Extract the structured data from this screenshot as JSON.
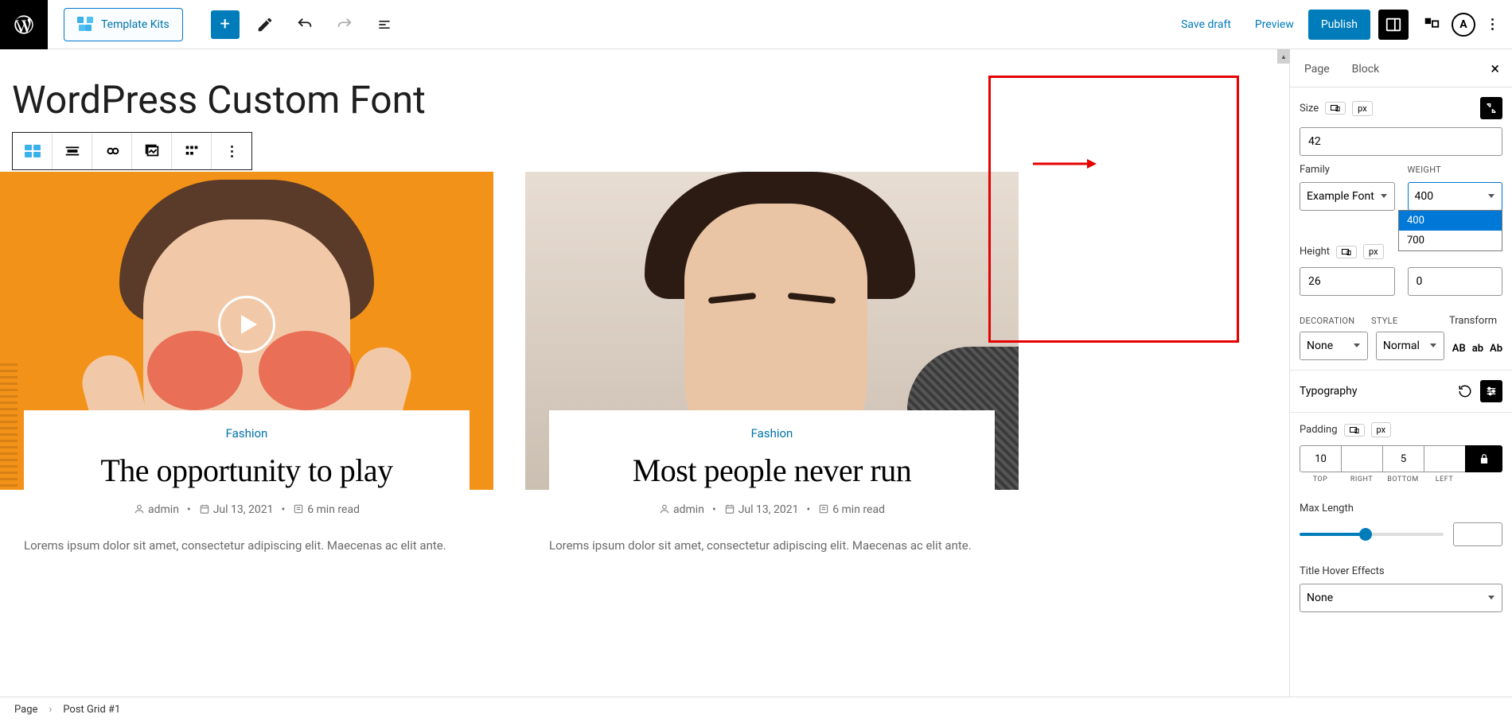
{
  "topbar": {
    "template_kits": "Template Kits",
    "save_draft": "Save draft",
    "preview": "Preview",
    "publish": "Publish",
    "astra": "A"
  },
  "canvas": {
    "page_title": "WordPress Custom Font"
  },
  "posts": [
    {
      "category": "Fashion",
      "title": "The opportunity to play",
      "author": "admin",
      "date": "Jul 13, 2021",
      "read": "6 min read",
      "excerpt": "Lorems ipsum dolor sit amet, consectetur adipiscing elit. Maecenas ac elit ante."
    },
    {
      "category": "Fashion",
      "title": "Most people never run",
      "author": "admin",
      "date": "Jul 13, 2021",
      "read": "6 min read",
      "excerpt": "Lorems ipsum dolor sit amet, consectetur adipiscing elit. Maecenas ac elit ante."
    }
  ],
  "sidebar": {
    "tabs": {
      "page": "Page",
      "block": "Block"
    },
    "size": {
      "label": "Size",
      "unit": "px",
      "value": "42"
    },
    "family": {
      "label": "Family",
      "value": "Example Font"
    },
    "weight": {
      "label": "WEIGHT",
      "value": "400",
      "options": [
        "400",
        "700"
      ]
    },
    "height": {
      "label": "Height",
      "unit": "px",
      "value": "26",
      "value2": "0"
    },
    "decoration": {
      "label": "DECORATION",
      "value": "None"
    },
    "style": {
      "label": "STYLE",
      "value": "Normal"
    },
    "transform": {
      "label": "Transform",
      "btn1": "AB",
      "btn2": "ab",
      "btn3": "Ab"
    },
    "typography": {
      "label": "Typography"
    },
    "padding": {
      "label": "Padding",
      "unit": "px",
      "top": "10",
      "right": "",
      "bottom": "5",
      "left": "",
      "l_top": "TOP",
      "l_right": "RIGHT",
      "l_bottom": "BOTTOM",
      "l_left": "LEFT"
    },
    "max_length": {
      "label": "Max Length"
    },
    "hover": {
      "label": "Title Hover Effects",
      "value": "None"
    }
  },
  "breadcrumb": {
    "page": "Page",
    "item": "Post Grid #1"
  }
}
